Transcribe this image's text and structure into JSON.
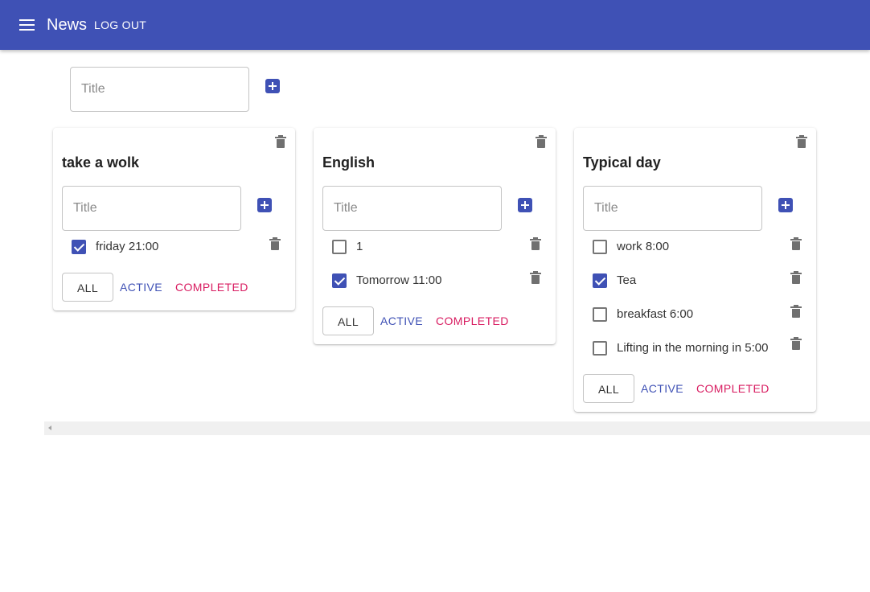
{
  "appbar": {
    "title": "News",
    "logout_label": "LOG OUT",
    "color": "#3f51b5"
  },
  "new_list": {
    "placeholder": "Title"
  },
  "filters": {
    "all": "ALL",
    "active": "ACTIVE",
    "completed": "COMPLETED"
  },
  "lists": [
    {
      "title": "take a wolk",
      "input_placeholder": "Title",
      "tasks": [
        {
          "label": "friday 21:00",
          "checked": true
        }
      ]
    },
    {
      "title": "English",
      "input_placeholder": "Title",
      "tasks": [
        {
          "label": "1",
          "checked": false
        },
        {
          "label": "Tomorrow 11:00",
          "checked": true
        }
      ]
    },
    {
      "title": "Typical day",
      "input_placeholder": "Title",
      "tasks": [
        {
          "label": "work 8:00",
          "checked": false
        },
        {
          "label": "Tea",
          "checked": true
        },
        {
          "label": "breakfast 6:00",
          "checked": false
        },
        {
          "label": "Lifting in the morning in 5:00",
          "checked": false
        }
      ]
    }
  ],
  "colors": {
    "primary": "#3f51b5",
    "completed": "#d81b60",
    "icon_grey": "#707070"
  },
  "icons": {
    "menu": "menu-icon",
    "add": "add-box-icon",
    "delete": "trash-icon",
    "scroll_left": "scroll-left-arrow-icon"
  }
}
